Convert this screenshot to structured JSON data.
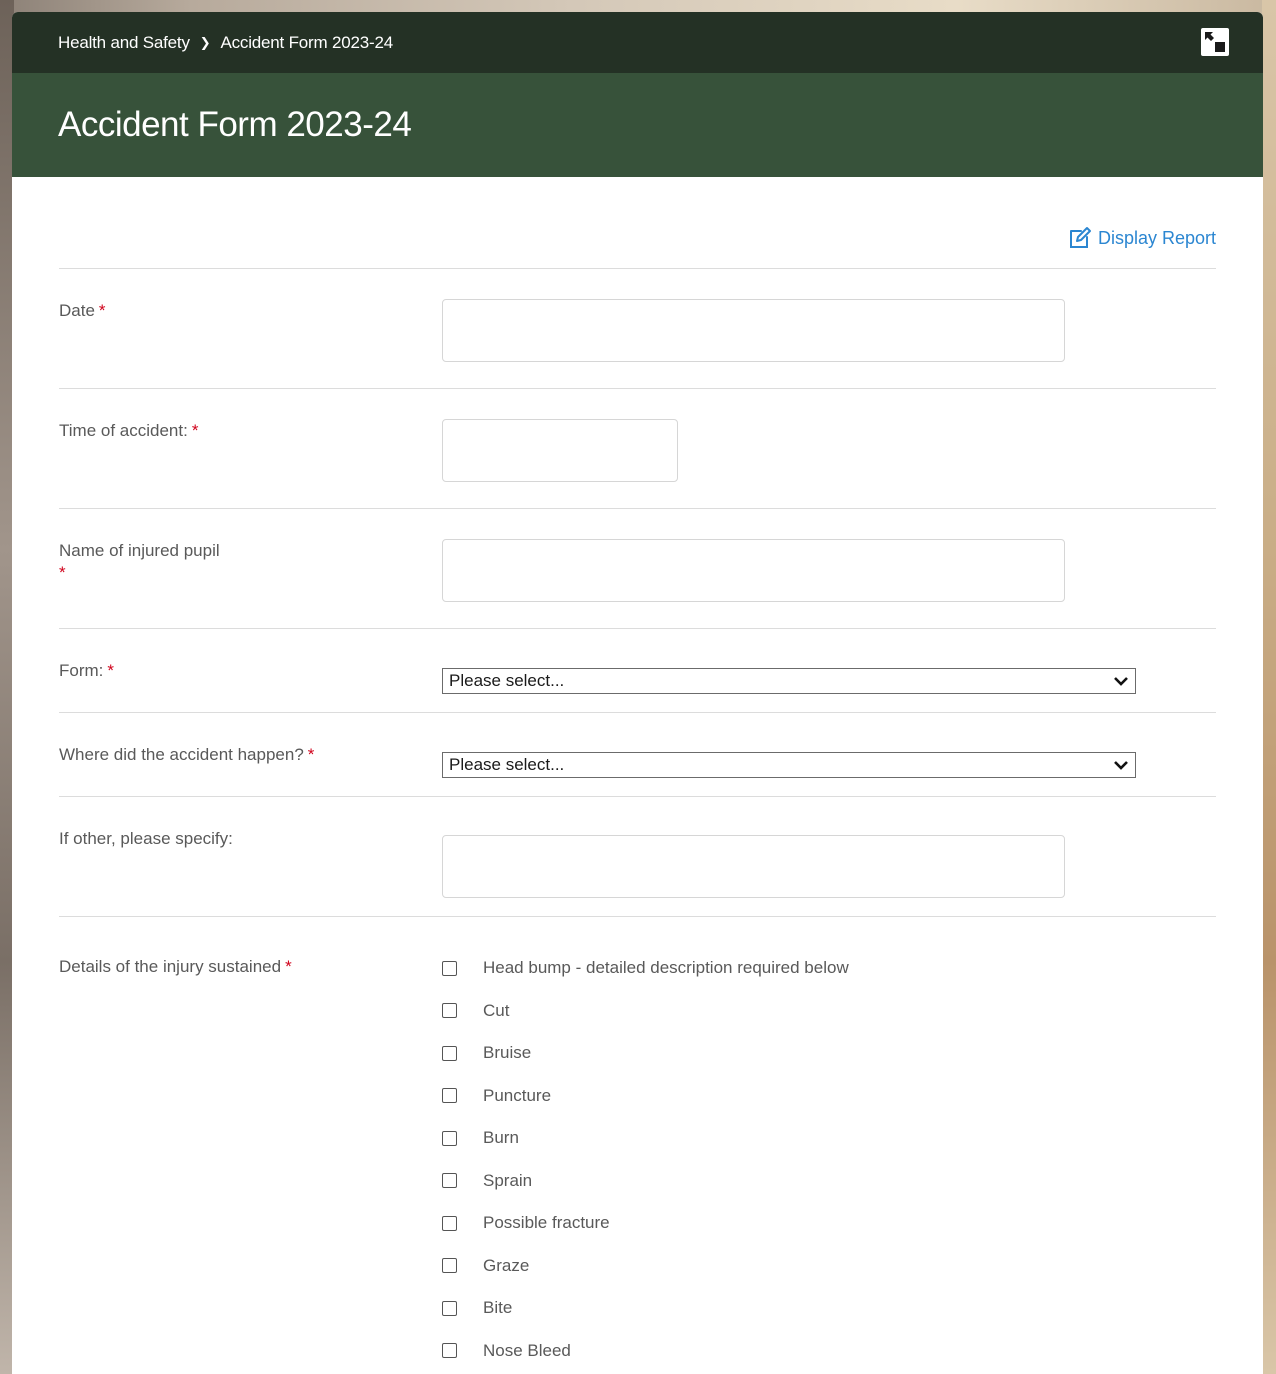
{
  "breadcrumb": {
    "parent": "Health and Safety",
    "current": "Accident Form 2023-24"
  },
  "page": {
    "title": "Accident Form 2023-24"
  },
  "toolbar": {
    "display_report": "Display Report"
  },
  "colors": {
    "topbar": "#243125",
    "titlebar": "#37523a",
    "link": "#2b86d1",
    "required": "#d0021b"
  },
  "fields": {
    "date": {
      "label": "Date",
      "required_mark": "*",
      "value": ""
    },
    "time": {
      "label": "Time of accident:",
      "required_mark": "*",
      "value": ""
    },
    "pupil_name": {
      "label": "Name of injured pupil",
      "required_mark": "*",
      "value": ""
    },
    "form": {
      "label": "Form:",
      "required_mark": "*",
      "selected": "Please select..."
    },
    "location": {
      "label": "Where did the accident happen?",
      "required_mark": "*",
      "selected": "Please select..."
    },
    "other": {
      "label": "If other, please specify:",
      "value": ""
    },
    "injury": {
      "label": "Details of the injury sustained",
      "required_mark": "*",
      "options": [
        "Head bump - detailed description required below",
        "Cut",
        "Bruise",
        "Puncture",
        "Burn",
        "Sprain",
        "Possible fracture",
        "Graze",
        "Bite",
        "Nose Bleed"
      ]
    }
  }
}
